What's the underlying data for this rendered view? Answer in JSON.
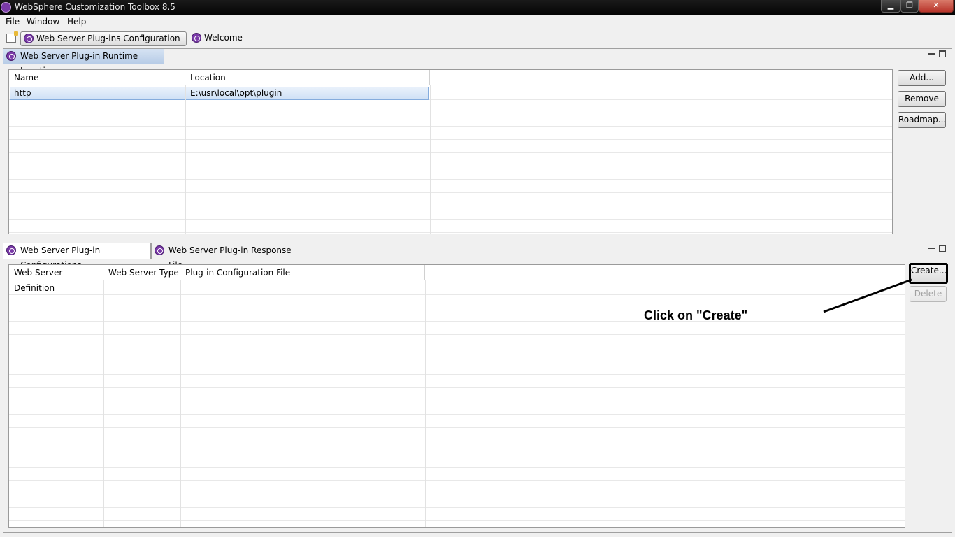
{
  "window": {
    "title": "WebSphere Customization Toolbox 8.5",
    "minimize_glyph": "▁",
    "maximize_glyph": "❐",
    "close_glyph": "✕"
  },
  "menu": [
    "File",
    "Window",
    "Help"
  ],
  "perspective_tabs": [
    {
      "label": "Web Server Plug-ins Configuration Tool",
      "icon": "websphere-icon",
      "active": true
    },
    {
      "label": "Welcome",
      "icon": "websphere-icon",
      "active": false
    }
  ],
  "runtime_panel": {
    "tab_label": "Web Server Plug-in Runtime Locations",
    "columns": [
      "Name",
      "Location"
    ],
    "rows": [
      {
        "name": "http",
        "location": "E:\\usr\\local\\opt\\plugin",
        "selected": true
      }
    ],
    "buttons": {
      "add": "Add...",
      "remove": "Remove",
      "roadmap": "Roadmap..."
    }
  },
  "config_panel": {
    "tabs": [
      {
        "label": "Web Server Plug-in Configurations",
        "selected": true
      },
      {
        "label": "Web Server Plug-in Response File",
        "selected": false
      }
    ],
    "columns": [
      "Web Server Definition",
      "Web Server Type",
      "Plug-in Configuration File"
    ],
    "rows": [],
    "buttons": {
      "create": "Create...",
      "delete": "Delete"
    },
    "delete_enabled": false
  },
  "annotation": {
    "text": "Click on \"Create\""
  }
}
